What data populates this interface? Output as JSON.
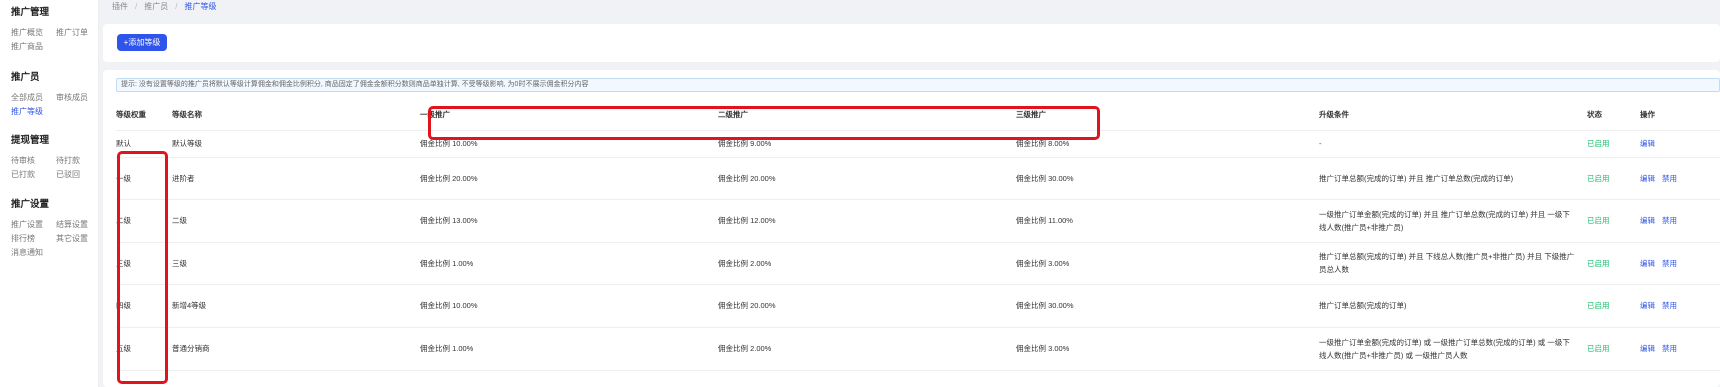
{
  "sidebar": {
    "groups": [
      {
        "title": "推广管理",
        "items": [
          "推广概览",
          "推广订单",
          "推广商品"
        ]
      },
      {
        "title": "推广员",
        "items": [
          "全部成员",
          "审核成员",
          "推广等级"
        ]
      },
      {
        "title": "提现管理",
        "items": [
          "待审核",
          "待打款",
          "已打款",
          "已驳回"
        ]
      },
      {
        "title": "推广设置",
        "items": [
          "推广设置",
          "结算设置",
          "排行榜",
          "其它设置",
          "消息通知"
        ]
      }
    ]
  },
  "breadcrumb": [
    "插件",
    "推广员",
    "推广等级"
  ],
  "toolbar": {
    "add_label": "+添加等级"
  },
  "tip": "提示: 没有设置等级的推广员将默认等级计算佣金和佣金比例积分, 商品固定了佣金金额积分数则商品单独计算, 不受等级影响, 为0时不展示佣金积分内容",
  "table": {
    "headers": [
      "等级权重",
      "等级名称",
      "一级推广",
      "二级推广",
      "三级推广",
      "升级条件",
      "状态",
      "操作"
    ],
    "rows": [
      {
        "weight": "默认",
        "name": "默认等级",
        "l1": "佣金比例 10.00%",
        "l2": "佣金比例 9.00%",
        "l3": "佣金比例 8.00%",
        "cond": "-",
        "status": "已启用",
        "actions": [
          "编辑"
        ]
      },
      {
        "weight": "一级",
        "name": "进阶者",
        "l1": "佣金比例 20.00%",
        "l2": "佣金比例 20.00%",
        "l3": "佣金比例 30.00%",
        "cond": "推广订单总额(完成的订单) 并且 推广订单总数(完成的订单)",
        "status": "已启用",
        "actions": [
          "编辑",
          "禁用"
        ]
      },
      {
        "weight": "二级",
        "name": "二级",
        "l1": "佣金比例 13.00%",
        "l2": "佣金比例 12.00%",
        "l3": "佣金比例 11.00%",
        "cond": "一级推广订单金额(完成的订单) 并且 推广订单总数(完成的订单) 并且 一级下线人数(推广员+非推广员)",
        "status": "已启用",
        "actions": [
          "编辑",
          "禁用"
        ]
      },
      {
        "weight": "三级",
        "name": "三级",
        "l1": "佣金比例 1.00%",
        "l2": "佣金比例 2.00%",
        "l3": "佣金比例 3.00%",
        "cond": "推广订单总额(完成的订单) 并且 下线总人数(推广员+非推广员) 并且 下级推广员总人数",
        "status": "已启用",
        "actions": [
          "编辑",
          "禁用"
        ]
      },
      {
        "weight": "四级",
        "name": "新增4等级",
        "l1": "佣金比例 10.00%",
        "l2": "佣金比例 20.00%",
        "l3": "佣金比例 30.00%",
        "cond": "推广订单总额(完成的订单)",
        "status": "已启用",
        "actions": [
          "编辑",
          "禁用"
        ]
      },
      {
        "weight": "五级",
        "name": "普通分销商",
        "l1": "佣金比例 1.00%",
        "l2": "佣金比例 2.00%",
        "l3": "佣金比例 3.00%",
        "cond": "一级推广订单金额(完成的订单) 或 一级推广订单总数(完成的订单) 或 一级下线人数(推广员+非推广员) 或 一级推广员人数",
        "status": "已启用",
        "actions": [
          "编辑",
          "禁用"
        ]
      }
    ]
  },
  "colors": {
    "accent": "#2f54eb",
    "enabled": "#19be6b",
    "highlight": "#e1141e"
  }
}
